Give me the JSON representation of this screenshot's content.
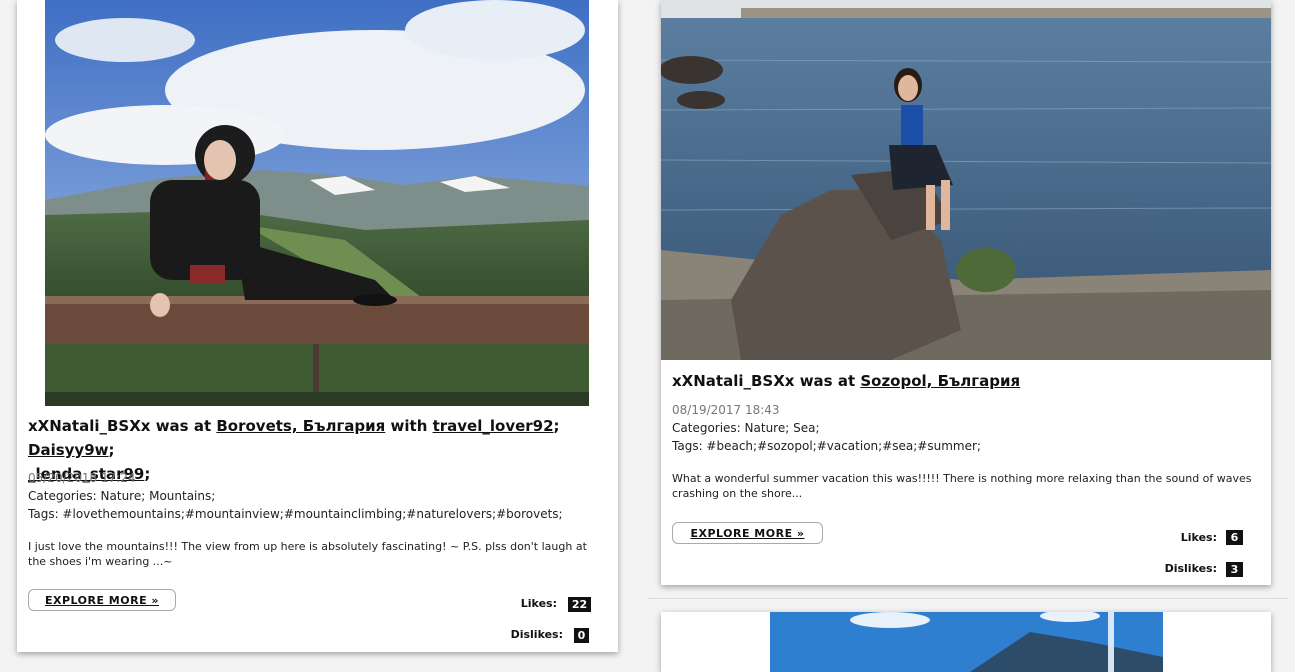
{
  "posts": [
    {
      "user": "xXNatali_BSXx",
      "was_at": " was at ",
      "location": "Borovets, България",
      "with_text": " with ",
      "friends": [
        "travel_lover92",
        "Daisyy9w",
        "_lenda_star99"
      ],
      "date": "05/20/2018 17:24",
      "categories": "Categories: Nature; Mountains;",
      "tags": "Tags: #lovethemountains;#mountainview;#mountainclimbing;#naturelovers;#borovets;",
      "description": "I just love the mountains!!! The view from up here is absolutely fascinating! ~ P.S. plss don't laugh at the shoes i'm wearing ...~",
      "explore_label": "EXPLORE MORE »",
      "likes_label": "Likes:",
      "likes": "22",
      "dislikes_label": "Dislikes:",
      "dislikes": "0"
    },
    {
      "user": "xXNatali_BSXx",
      "was_at": " was at ",
      "location": "Sozopol, България",
      "date": "08/19/2017 18:43",
      "categories": "Categories: Nature; Sea;",
      "tags": "Tags: #beach;#sozopol;#vacation;#sea;#summer;",
      "description": "What a wonderful summer vacation this was!!!!! There is nothing more relaxing than the sound of waves crashing on the shore...",
      "explore_label": "EXPLORE MORE »",
      "likes_label": "Likes:",
      "likes": "6",
      "dislikes_label": "Dislikes:",
      "dislikes": "3"
    }
  ]
}
